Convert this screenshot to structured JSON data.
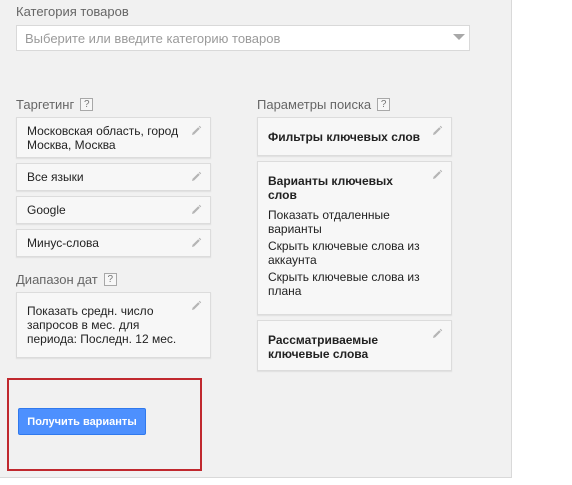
{
  "category": {
    "label": "Категория товаров",
    "placeholder": "Выберите или введите категорию товаров"
  },
  "targeting": {
    "label": "Таргетинг",
    "help": "?",
    "items": [
      {
        "label": "Московская область, город Москва, Москва"
      },
      {
        "label": "Все языки"
      },
      {
        "label": "Google"
      },
      {
        "label": "Минус-слова"
      }
    ]
  },
  "date_range": {
    "label": "Диапазон дат",
    "help": "?",
    "value": "Показать средн. число запросов в мес. для периода: Последн. 12 мес."
  },
  "search_params": {
    "label": "Параметры поиска",
    "help": "?",
    "filters_title": "Фильтры ключевых слов",
    "variants_title": "Варианты ключевых слов",
    "variants_options": [
      "Показать отдаленные варианты",
      "Скрыть ключевые слова из аккаунта",
      "Скрыть ключевые слова из плана"
    ],
    "considered_title": "Рассматриваемые ключевые слова"
  },
  "actions": {
    "get_ideas": "Получить варианты"
  },
  "colors": {
    "button_blue": "#4d90fe",
    "highlight_red": "#c0282e",
    "panel_bg": "#f1f1f1"
  },
  "icons": {
    "edit": "pencil-icon",
    "dropdown": "caret-down-icon"
  }
}
